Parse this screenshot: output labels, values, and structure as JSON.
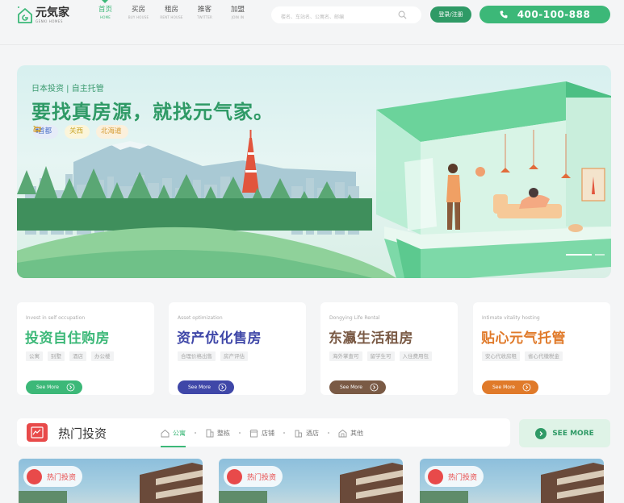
{
  "header": {
    "logo_cn": "元気家",
    "logo_en": "GENKI HOMES",
    "nav": [
      {
        "cn": "首页",
        "en": "HOME",
        "active": true
      },
      {
        "cn": "买房",
        "en": "BUY HOUSE",
        "active": false
      },
      {
        "cn": "租房",
        "en": "RENT HOUSE",
        "active": false
      },
      {
        "cn": "推客",
        "en": "TWITTER",
        "active": false
      },
      {
        "cn": "加盟",
        "en": "JOIN IN",
        "active": false
      }
    ],
    "search_placeholder": "楼名、车站名、公寓名、邮编",
    "login_label": "登录/注册",
    "phone": "400-100-888"
  },
  "banner": {
    "subtitle": "日本投资 | 自主托管",
    "title": "要找真房源，就找元气家。",
    "tags": [
      {
        "label": "首都",
        "icon": "tower-icon"
      },
      {
        "label": "关西",
        "icon": "cart-icon"
      },
      {
        "label": "北海道",
        "icon": "car-icon"
      }
    ]
  },
  "cards": [
    {
      "en": "Invest in self occupation",
      "title": "投资自住购房",
      "tags": [
        "公寓",
        "别墅",
        "酒店",
        "办公楼"
      ],
      "button": "See More",
      "color": "#3cb878"
    },
    {
      "en": "Asset optimization",
      "title": "资产优化售房",
      "tags": [
        "合理价格出售",
        "房产评估"
      ],
      "button": "See More",
      "color": "#3f47a8"
    },
    {
      "en": "Dongying Life Rental",
      "title": "东瀛生活租房",
      "tags": [
        "海外掌查可",
        "留学生可",
        "入住费用包"
      ],
      "button": "See More",
      "color": "#7a5a45"
    },
    {
      "en": "Intimate vitality hosting",
      "title": "贴心元气托管",
      "tags": [
        "安心代收房租",
        "省心代缴税金"
      ],
      "button": "See More",
      "color": "#e07a2a"
    }
  ],
  "hot": {
    "title": "热门投资",
    "tabs": [
      {
        "label": "公寓",
        "icon": "house-icon",
        "active": true
      },
      {
        "label": "整栋",
        "icon": "building-icon",
        "active": false
      },
      {
        "label": "店铺",
        "icon": "shop-icon",
        "active": false
      },
      {
        "label": "酒店",
        "icon": "hotel-icon",
        "active": false
      },
      {
        "label": "其他",
        "icon": "other-icon",
        "active": false
      }
    ],
    "see_more": "SEE MORE",
    "badge": "热门投资"
  },
  "colors": {
    "brand": "#3cb878",
    "brand_dark": "#2f9a66",
    "hot": "#e84a4a"
  }
}
